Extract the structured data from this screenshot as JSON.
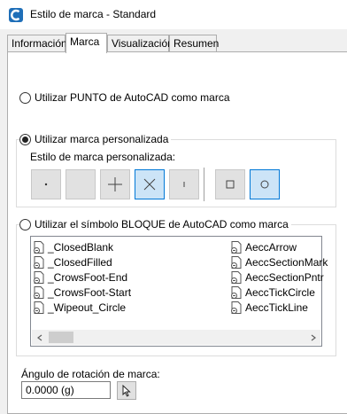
{
  "window": {
    "title": "Estilo de marca - Standard",
    "app_icon": "civil3d-c-icon",
    "accent": "#1f6fb8"
  },
  "tabs": [
    {
      "label": "Información",
      "active": false
    },
    {
      "label": "Marca",
      "active": true
    },
    {
      "label": "Visualización",
      "active": false
    },
    {
      "label": "Resumen",
      "active": false
    }
  ],
  "marker": {
    "option_point": {
      "label": "Utilizar PUNTO de AutoCAD como marca",
      "checked": false
    },
    "option_custom": {
      "label": "Utilizar marca personalizada",
      "checked": true
    },
    "custom_style_label": "Estilo de marca personalizada:",
    "custom_buttons": [
      {
        "icon": "dot-icon",
        "selected": false
      },
      {
        "icon": "blank-icon",
        "selected": false
      },
      {
        "icon": "plus-icon",
        "selected": false
      },
      {
        "icon": "x-icon",
        "selected": true
      },
      {
        "icon": "tick-icon",
        "selected": false
      },
      {
        "icon": "square-icon",
        "selected": false
      },
      {
        "icon": "circle-icon",
        "selected": true
      }
    ],
    "option_block": {
      "label": "Utilizar el símbolo BLOQUE de AutoCAD como marca",
      "checked": false
    },
    "blocks_col1": [
      "_ClosedBlank",
      "_ClosedFilled",
      "_CrowsFoot-End",
      "_CrowsFoot-Start",
      "_Wipeout_Circle"
    ],
    "blocks_col2": [
      "AeccArrow",
      "AeccSectionMark",
      "AeccSectionPntr",
      "AeccTickCircle",
      "AeccTickLine"
    ],
    "rotation_label": "Ángulo de rotación de marca:",
    "rotation_value": "0.0000 (g)"
  }
}
